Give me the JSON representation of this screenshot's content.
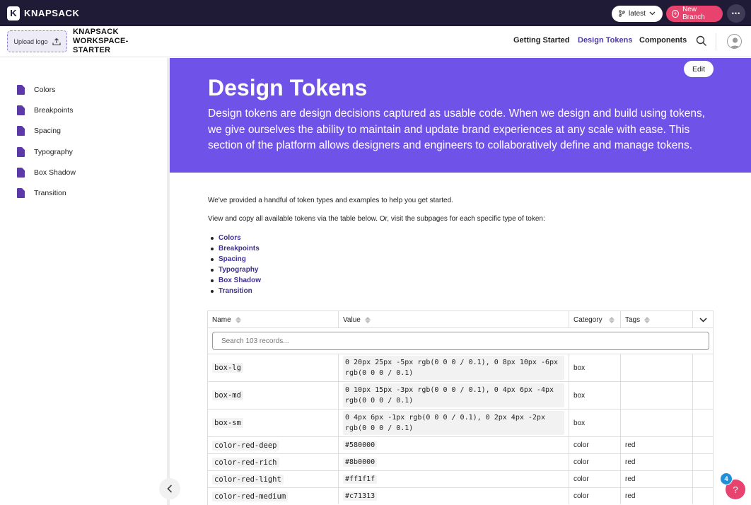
{
  "topbar": {
    "brand_logo": "K",
    "brand_name": "KNAPSACK",
    "branch_label": "latest",
    "new_branch_label": "New Branch",
    "more_label": "•••",
    "colors": {
      "bg": "#1f1b36",
      "accent": "#e8436e"
    }
  },
  "header": {
    "upload_label": "Upload logo",
    "workspace_title": "KNAPSACK WORKSPACE-STARTER",
    "nav": [
      "Getting Started",
      "Design Tokens",
      "Components"
    ],
    "active_nav": "Design Tokens"
  },
  "sidebar": {
    "items": [
      "Colors",
      "Breakpoints",
      "Spacing",
      "Typography",
      "Box Shadow",
      "Transition"
    ]
  },
  "hero": {
    "title": "Design Tokens",
    "description": "Design tokens are design decisions captured as usable code. When we design and build using tokens, we give ourselves the ability to maintain and update brand experiences at any scale with ease. This section of the platform allows designers and engineers to collaboratively define and manage tokens.",
    "edit_label": "Edit",
    "bg_color": "#6f53e8"
  },
  "content": {
    "intro": "We've provided a handful of token types and examples to help you get started.",
    "intro2": "View and copy all available tokens via the table below. Or, visit the subpages for each specific type of token:",
    "links": [
      "Colors",
      "Breakpoints",
      "Spacing",
      "Typography",
      "Box Shadow",
      "Transition"
    ]
  },
  "table": {
    "columns": [
      "Name",
      "Value",
      "Category",
      "Tags"
    ],
    "search_placeholder": "Search 103 records...",
    "rows": [
      {
        "name": "box-lg",
        "value": "0 20px 25px -5px rgb(0 0 0 / 0.1), 0 8px 10px -6px rgb(0 0 0 / 0.1)",
        "category": "box",
        "tags": ""
      },
      {
        "name": "box-md",
        "value": "0 10px 15px -3px rgb(0 0 0 / 0.1), 0 4px 6px -4px rgb(0 0 0 / 0.1)",
        "category": "box",
        "tags": ""
      },
      {
        "name": "box-sm",
        "value": "0 4px 6px -1px rgb(0 0 0 / 0.1), 0 2px 4px -2px rgb(0 0 0 / 0.1)",
        "category": "box",
        "tags": ""
      },
      {
        "name": "color-red-deep",
        "value": "#580000",
        "category": "color",
        "tags": "red"
      },
      {
        "name": "color-red-rich",
        "value": "#8b0000",
        "category": "color",
        "tags": "red"
      },
      {
        "name": "color-red-light",
        "value": "#ff1f1f",
        "category": "color",
        "tags": "red"
      },
      {
        "name": "color-red-medium",
        "value": "#c71313",
        "category": "color",
        "tags": "red"
      }
    ]
  },
  "help": {
    "icon": "?",
    "badge_count": "4"
  }
}
